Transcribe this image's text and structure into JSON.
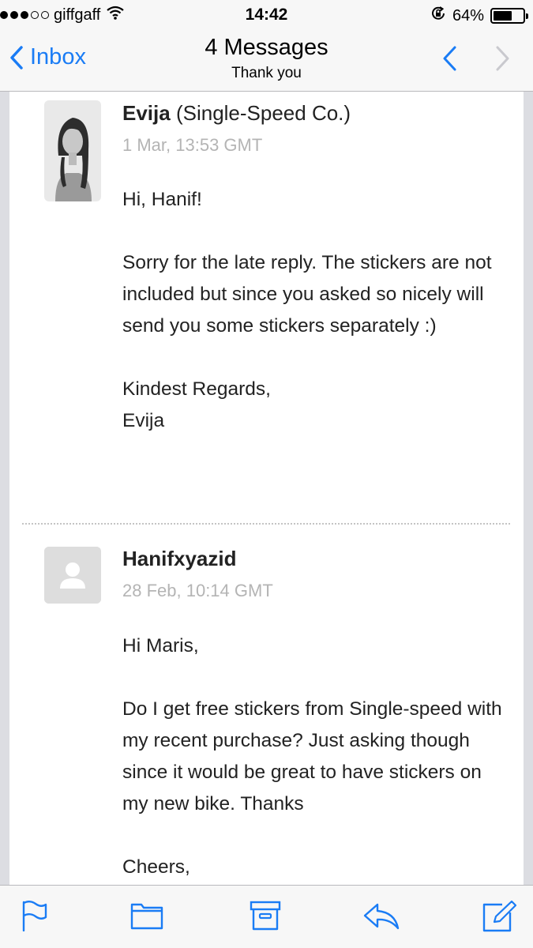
{
  "status_bar": {
    "carrier": "giffgaff",
    "time": "14:42",
    "battery": "64%",
    "battery_level": 0.64
  },
  "nav": {
    "back_label": "Inbox",
    "title": "4 Messages",
    "subtitle": "Thank you"
  },
  "messages": [
    {
      "sender_name": "Evija",
      "sender_org": "(Single-Speed Co.)",
      "date": "1 Mar, 13:53 GMT",
      "body": [
        "Hi, Hanif!",
        "Sorry for the late reply. The stickers are not included but since you asked so nicely will send you some stickers separately :)",
        "Kindest Regards,",
        "Evija"
      ]
    },
    {
      "sender_name": "Hanifxyazid",
      "date": "28 Feb, 10:14 GMT",
      "body": [
        "Hi Maris,",
        "Do I get free stickers from Single-speed with my recent purchase? Just asking though since it would be great to have stickers on my new bike. Thanks",
        "Cheers,"
      ]
    }
  ],
  "toolbar": {
    "icons": [
      "flag-icon",
      "folder-icon",
      "archive-icon",
      "reply-icon",
      "compose-icon"
    ]
  },
  "colors": {
    "accent": "#1a7cf5",
    "date_gray": "#b4b4b4",
    "background": "#dcdde2"
  }
}
